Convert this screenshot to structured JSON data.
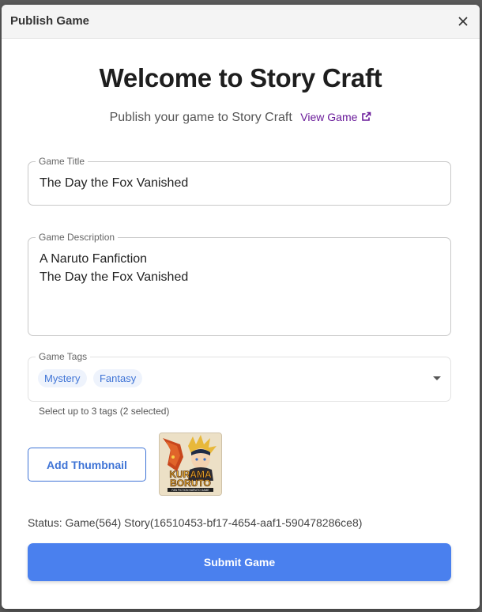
{
  "dialog": {
    "title": "Publish Game",
    "close_icon": "close-icon"
  },
  "welcome": {
    "heading": "Welcome to Story Craft",
    "subtitle": "Publish your game to Story Craft",
    "view_link": "View Game",
    "view_link_icon": "external-link-icon"
  },
  "form": {
    "title_field": {
      "label": "Game Title",
      "value": "The Day the Fox Vanished"
    },
    "description_field": {
      "label": "Game Description",
      "lines": [
        "A Naruto Fanfiction",
        "The Day the Fox Vanished"
      ]
    },
    "tags_field": {
      "label": "Game Tags",
      "selected": [
        "Mystery",
        "Fantasy"
      ],
      "helper": "Select up to 3 tags (2 selected)",
      "dropdown_icon": "dropdown-arrow-icon"
    },
    "thumbnail": {
      "button_label": "Add Thumbnail",
      "image_text_top": "KURAMA",
      "image_text_bottom": "BORUTO",
      "image_caption": "FAN FICTION NARUTO GAME"
    }
  },
  "status": "Status: Game(564) Story(16510453-bf17-4654-aaf1-590478286ce8)",
  "submit_label": "Submit Game",
  "colors": {
    "accent": "#4a80ee",
    "link": "#6a1b9a",
    "chip_text": "#3f74d6",
    "chip_bg": "#eef3fc"
  }
}
